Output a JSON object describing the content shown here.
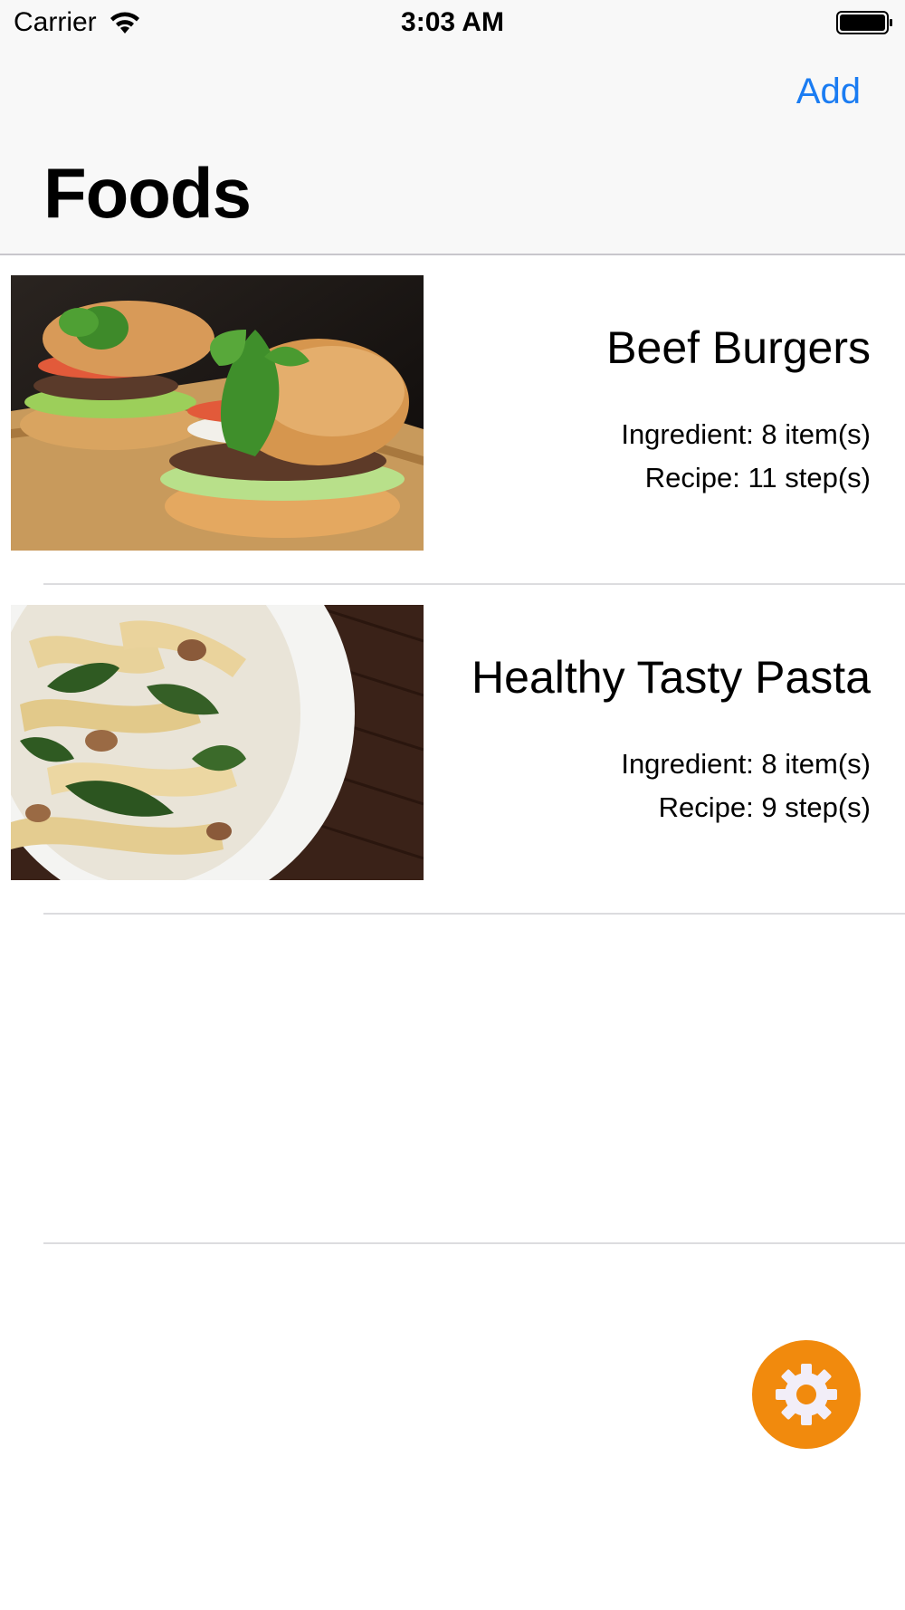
{
  "status_bar": {
    "carrier": "Carrier",
    "time": "3:03 AM"
  },
  "nav": {
    "add_label": "Add",
    "title": "Foods"
  },
  "foods": [
    {
      "name": "Beef Burgers",
      "ingredients": "Ingredient: 8 item(s)",
      "recipe": "Recipe: 11 step(s)",
      "image_icon": "burger-photo"
    },
    {
      "name": "Healthy Tasty Pasta",
      "ingredients": "Ingredient: 8 item(s)",
      "recipe": "Recipe: 9 step(s)",
      "image_icon": "pasta-photo"
    }
  ],
  "colors": {
    "accent": "#1a7cf2",
    "fab": "#f18a0d",
    "bar_background": "#f8f8f8"
  },
  "fab": {
    "icon": "gear-icon"
  }
}
